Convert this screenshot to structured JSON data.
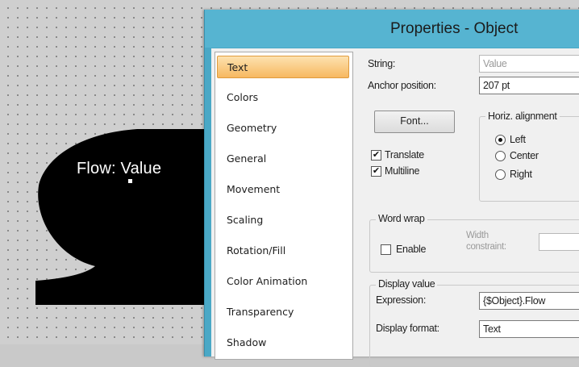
{
  "canvas": {
    "object_label": "Flow: Value"
  },
  "dialog": {
    "title": "Properties - Object",
    "categories": [
      {
        "label": "Text",
        "selected": true
      },
      {
        "label": "Colors"
      },
      {
        "label": "Geometry"
      },
      {
        "label": "General"
      },
      {
        "label": "Movement"
      },
      {
        "label": "Scaling"
      },
      {
        "label": "Rotation/Fill"
      },
      {
        "label": "Color Animation"
      },
      {
        "label": "Transparency"
      },
      {
        "label": "Shadow"
      }
    ],
    "string_label": "String:",
    "string_value": "Value",
    "anchor_label": "Anchor position:",
    "anchor_value": "207 pt",
    "font_button": "Font...",
    "translate_label": "Translate",
    "translate_checked": true,
    "multiline_label": "Multiline",
    "multiline_checked": true,
    "horiz_group_title": "Horiz. alignment",
    "align_options": [
      {
        "label": "Left",
        "selected": true
      },
      {
        "label": "Center"
      },
      {
        "label": "Right"
      }
    ],
    "wordwrap_group_title": "Word wrap",
    "enable_label": "Enable",
    "enable_checked": false,
    "width_constraint_label_1": "Width",
    "width_constraint_label_2": "constraint:",
    "width_constraint_value": "",
    "display_group_title": "Display value",
    "expression_label": "Expression:",
    "expression_value": "{$Object}.Flow",
    "display_format_label": "Display format:",
    "display_format_value": "Text"
  }
}
